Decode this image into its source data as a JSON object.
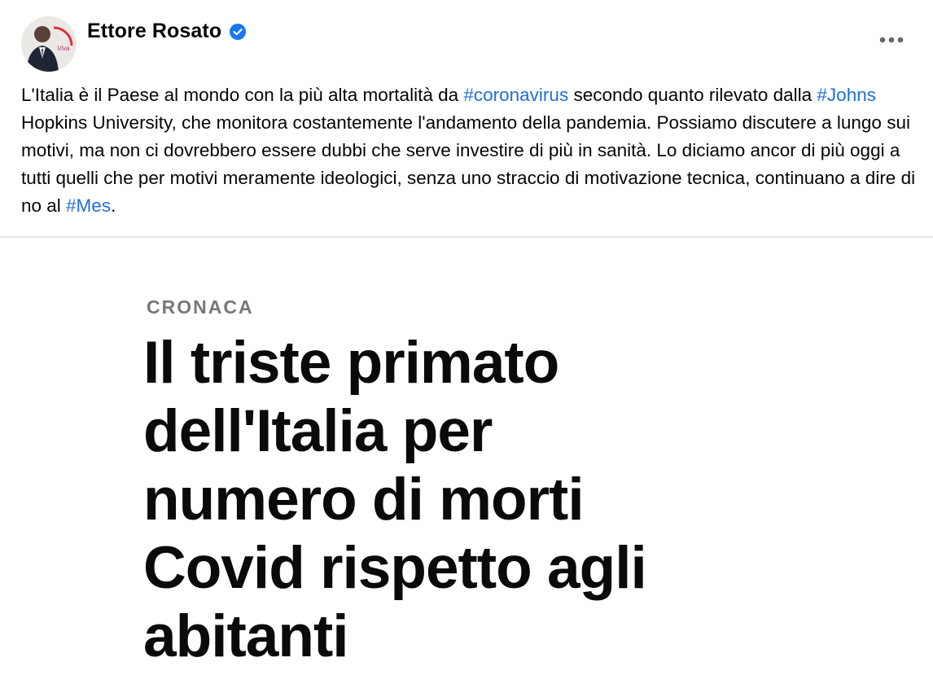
{
  "post": {
    "author": "Ettore Rosato",
    "verified": true,
    "body": [
      {
        "type": "text",
        "value": "L'Italia è il Paese al mondo con la più alta mortalità da "
      },
      {
        "type": "hashtag",
        "value": "#coronavirus"
      },
      {
        "type": "text",
        "value": " secondo quanto rilevato dalla "
      },
      {
        "type": "hashtag",
        "value": "#Johns"
      },
      {
        "type": "text",
        "value": " Hopkins University, che monitora costantemente l'andamento della pandemia. Possiamo discutere a lungo sui motivi, ma non ci dovrebbero essere dubbi che serve investire di più in sanità. Lo diciamo ancor di più oggi a tutti quelli che per motivi meramente ideologici, senza uno straccio di motivazione tecnica, continuano a dire di no al "
      },
      {
        "type": "hashtag",
        "value": "#Mes"
      },
      {
        "type": "text",
        "value": "."
      }
    ],
    "avatar_badge_text": "Viva"
  },
  "article": {
    "kicker": "CRONACA",
    "headline_lines": [
      "Il triste primato",
      "dell'Italia per",
      "numero di morti",
      "Covid rispetto agli",
      "abitanti"
    ]
  },
  "icons": {
    "verified": "verified-badge-icon",
    "more": "more-options-icon"
  },
  "colors": {
    "hashtag": "#216fdb",
    "verified": "#1877f2",
    "kicker": "#77777b"
  }
}
